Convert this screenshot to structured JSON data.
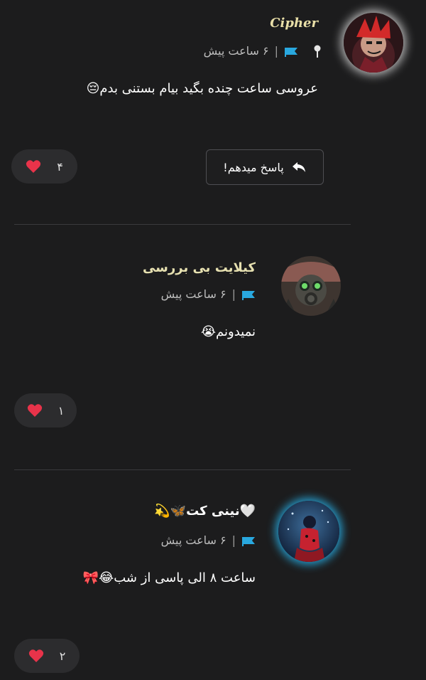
{
  "comments": [
    {
      "username": "Cipher",
      "time": "۶ ساعت پیش",
      "separator": "|",
      "message": "عروسی ساعت چنده بگید بیام بستنی بدم😔",
      "likes": "۴",
      "pinned": true
    },
    {
      "username": "کیلایت بی بررسی",
      "time": "۶ ساعت پیش",
      "separator": "|",
      "message": "نمیدونم😭",
      "likes": "۱"
    },
    {
      "username": "🤍نینی کت🦋💫",
      "time": "۶ ساعت پیش",
      "separator": "|",
      "message": "ساعت ۸ الی پاسی از شب😂🎀",
      "likes": "۲"
    }
  ],
  "reply_button": {
    "label": "پاسخ میدهم!"
  },
  "icons": {
    "pin": "pin-icon",
    "flag": "flag-icon",
    "heart": "heart-icon",
    "reply": "reply-arrow-icon"
  },
  "colors": {
    "background": "#1c1c1d",
    "flag": "#29a8df",
    "heart": "#e8334a",
    "username_gold": "#e9dfa8"
  }
}
